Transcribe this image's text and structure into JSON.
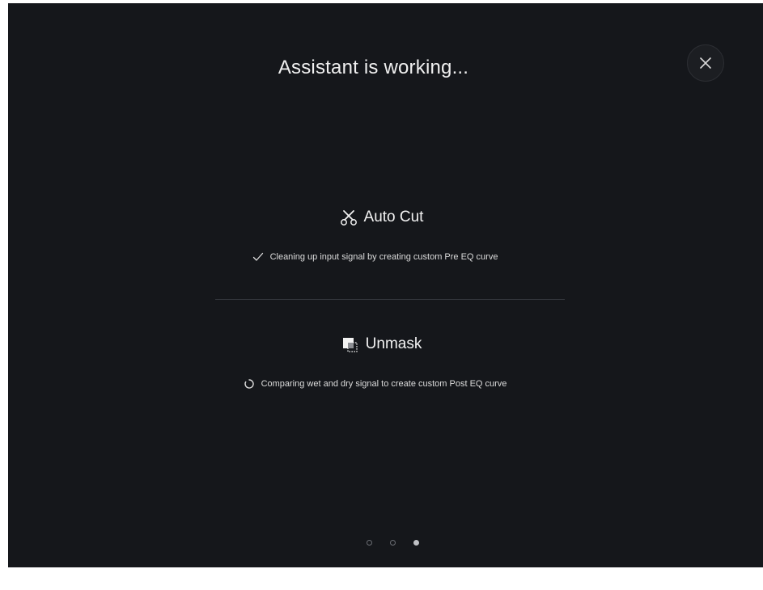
{
  "dialog": {
    "title": "Assistant is working..."
  },
  "close_button": {
    "icon": "close-icon"
  },
  "sections": [
    {
      "heading": "Auto Cut",
      "icon": "scissors-icon",
      "status_icon": "checkmark-icon",
      "status_text": "Cleaning up input signal by creating custom Pre EQ curve",
      "state": "done"
    },
    {
      "heading": "Unmask",
      "icon": "unmask-icon",
      "status_icon": "spinner-icon",
      "status_text": "Comparing wet and dry signal to create custom Post EQ curve",
      "state": "in-progress"
    }
  ],
  "pager": {
    "total": 3,
    "active_index": 3
  },
  "colors": {
    "background": "#15171b",
    "text": "#f0f0f0",
    "divider": "#33363c"
  }
}
